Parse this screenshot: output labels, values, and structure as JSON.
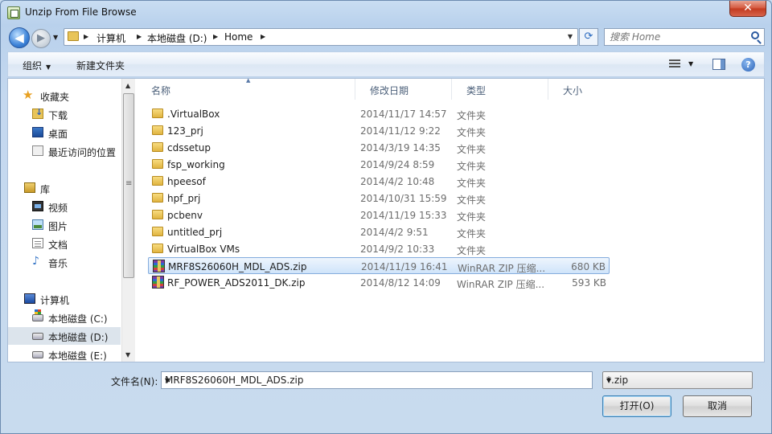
{
  "window": {
    "title": "Unzip From File Browse",
    "close_label": "✕"
  },
  "nav": {
    "back_glyph": "◀",
    "forward_glyph": "▶",
    "breadcrumbs": [
      "计算机",
      "本地磁盘 (D:)",
      "Home"
    ],
    "refresh_glyph": "⟳",
    "search_placeholder": "搜索 Home"
  },
  "toolbar": {
    "organize": "组织",
    "new_folder": "新建文件夹",
    "help": "?"
  },
  "sidebar": {
    "items": [
      {
        "label": "收藏夹",
        "icon": "star-icon"
      },
      {
        "label": "下载",
        "icon": "downloads-folder-icon"
      },
      {
        "label": "桌面",
        "icon": "desktop-icon"
      },
      {
        "label": "最近访问的位置",
        "icon": "recent-places-icon"
      },
      {
        "label": "库",
        "icon": "library-icon"
      },
      {
        "label": "视频",
        "icon": "video-icon"
      },
      {
        "label": "图片",
        "icon": "pictures-icon"
      },
      {
        "label": "文档",
        "icon": "documents-icon"
      },
      {
        "label": "音乐",
        "icon": "music-icon"
      },
      {
        "label": "计算机",
        "icon": "computer-icon"
      },
      {
        "label": "本地磁盘 (C:)",
        "icon": "system-drive-icon"
      },
      {
        "label": "本地磁盘 (D:)",
        "icon": "drive-icon",
        "selected": true
      },
      {
        "label": "本地磁盘 (E:)",
        "icon": "drive-icon"
      }
    ]
  },
  "files": {
    "columns": [
      "名称",
      "修改日期",
      "类型",
      "大小"
    ],
    "rows": [
      {
        "name": ".VirtualBox",
        "date": "2014/11/17 14:57",
        "type": "文件夹",
        "size": "",
        "kind": "folder"
      },
      {
        "name": "123_prj",
        "date": "2014/11/12 9:22",
        "type": "文件夹",
        "size": "",
        "kind": "folder"
      },
      {
        "name": "cdssetup",
        "date": "2014/3/19 14:35",
        "type": "文件夹",
        "size": "",
        "kind": "folder"
      },
      {
        "name": "fsp_working",
        "date": "2014/9/24 8:59",
        "type": "文件夹",
        "size": "",
        "kind": "folder"
      },
      {
        "name": "hpeesof",
        "date": "2014/4/2 10:48",
        "type": "文件夹",
        "size": "",
        "kind": "folder"
      },
      {
        "name": "hpf_prj",
        "date": "2014/10/31 15:59",
        "type": "文件夹",
        "size": "",
        "kind": "folder"
      },
      {
        "name": "pcbenv",
        "date": "2014/11/19 15:33",
        "type": "文件夹",
        "size": "",
        "kind": "folder"
      },
      {
        "name": "untitled_prj",
        "date": "2014/4/2 9:51",
        "type": "文件夹",
        "size": "",
        "kind": "folder"
      },
      {
        "name": "VirtualBox VMs",
        "date": "2014/9/2 10:33",
        "type": "文件夹",
        "size": "",
        "kind": "folder"
      },
      {
        "name": "MRF8S26060H_MDL_ADS.zip",
        "date": "2014/11/19 16:41",
        "type": "WinRAR ZIP 压缩...",
        "size": "680 KB",
        "kind": "zip",
        "selected": true
      },
      {
        "name": "RF_POWER_ADS2011_DK.zip",
        "date": "2014/8/12 14:09",
        "type": "WinRAR ZIP 压缩...",
        "size": "593 KB",
        "kind": "zip"
      }
    ]
  },
  "footer": {
    "filename_label": "文件名(N):",
    "filename_value": "MRF8S26060H_MDL_ADS.zip",
    "filter_value": "*.zip",
    "open_label": "打开(O)",
    "cancel_label": "取消"
  }
}
